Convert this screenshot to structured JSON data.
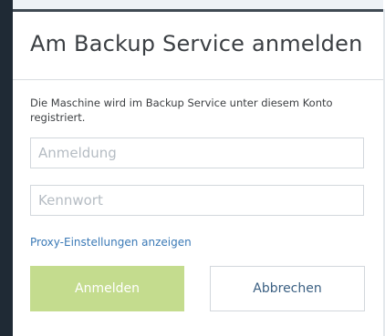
{
  "dialog": {
    "title": "Am Backup Service anmelden",
    "description": "Die Maschine wird im Backup Service unter diesem Konto registriert.",
    "login_placeholder": "Anmeldung",
    "password_placeholder": "Kennwort",
    "proxy_link": "Proxy-Einstellungen anzeigen",
    "login_button": "Anmelden",
    "cancel_button": "Abbrechen"
  },
  "colors": {
    "primary_button": "#c4dc8e",
    "link": "#3a79b6",
    "backdrop": "#1f2a35"
  }
}
